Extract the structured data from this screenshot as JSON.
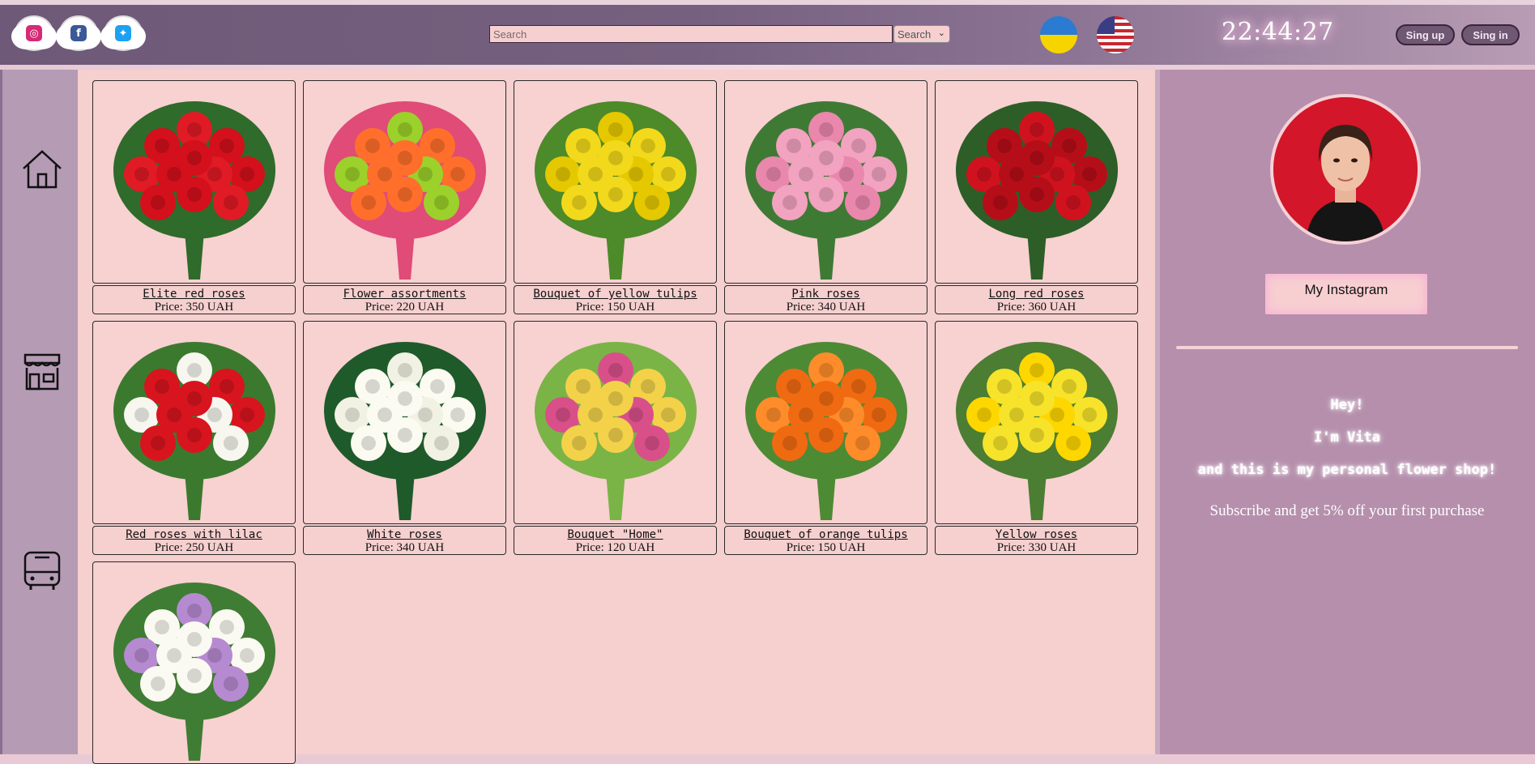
{
  "header": {
    "social": [
      {
        "name": "instagram-icon",
        "glyph": "◎",
        "color": "#d62976"
      },
      {
        "name": "facebook-icon",
        "glyph": "f",
        "color": "#3b5998"
      },
      {
        "name": "twitter-icon",
        "glyph": "🐦",
        "color": "#1da1f2"
      }
    ],
    "search": {
      "placeholder": "Search",
      "value": "",
      "select_value": "Search"
    },
    "flags": [
      "ukraine-flag-icon",
      "usa-flag-icon"
    ],
    "clock": "22:44:27",
    "signup_label": "Sing up",
    "signin_label": "Sing in"
  },
  "nav": [
    "home-icon",
    "shop-icon",
    "bus-icon"
  ],
  "products": [
    {
      "name": "Elite red roses",
      "price": "Price: 350 UAH",
      "colors": [
        "#d3101c",
        "#e01b25",
        "#2f6b2a"
      ]
    },
    {
      "name": "Flower assortments",
      "price": "Price: 220 UAH",
      "colors": [
        "#ff6f2b",
        "#9bd12a",
        "#e04b78"
      ]
    },
    {
      "name": "Bouquet of yellow tulips",
      "price": "Price: 150 UAH",
      "colors": [
        "#f3d91b",
        "#e5c800",
        "#4c8a2a"
      ]
    },
    {
      "name": "Pink roses",
      "price": "Price: 340 UAH",
      "colors": [
        "#f2a3c0",
        "#ea87ad",
        "#3f7a35"
      ]
    },
    {
      "name": "Long red roses",
      "price": "Price: 360 UAH",
      "colors": [
        "#b60e18",
        "#d0121f",
        "#2d5e28"
      ]
    },
    {
      "name": "Red roses with lilac",
      "price": "Price: 250 UAH",
      "colors": [
        "#d8141f",
        "#f7f7f0",
        "#3b7a2e"
      ]
    },
    {
      "name": "White roses",
      "price": "Price: 340 UAH",
      "colors": [
        "#fbfbf2",
        "#f2f2e4",
        "#1f5a2a"
      ]
    },
    {
      "name": "Bouquet \"Home\"",
      "price": "Price: 120 UAH",
      "colors": [
        "#f3d24a",
        "#d94f8a",
        "#7ab446"
      ]
    },
    {
      "name": "Bouquet of orange tulips",
      "price": "Price: 150 UAH",
      "colors": [
        "#f06a12",
        "#ff8c2a",
        "#4d8a34"
      ]
    },
    {
      "name": "Yellow roses",
      "price": "Price: 330 UAH",
      "colors": [
        "#f7e32a",
        "#ffd700",
        "#4b7d33"
      ]
    },
    {
      "name": "",
      "price": "",
      "colors": [
        "#fbfaf2",
        "#b68ad0",
        "#3f7d34"
      ]
    }
  ],
  "sidebar": {
    "instagram_label": "My Instagram",
    "greeting_1": "Hey!",
    "greeting_2": "I'm Vita",
    "greeting_3": "and this is my personal flower shop!",
    "subscribe_text": "Subscribe and get 5% off your first purchase"
  }
}
